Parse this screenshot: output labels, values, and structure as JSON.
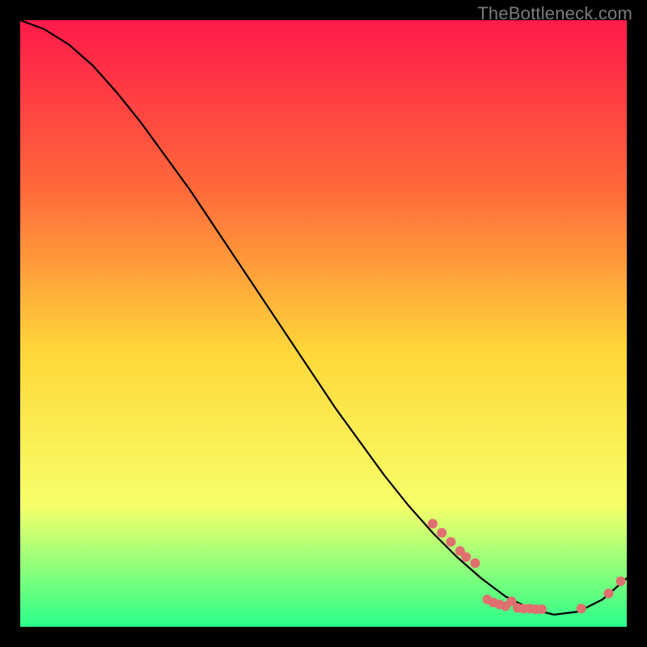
{
  "watermark": "TheBottleneck.com",
  "colors": {
    "background": "#000000",
    "gradient_top": "#ff1a4a",
    "gradient_mid_upper": "#ff6a3a",
    "gradient_mid": "#ffd83a",
    "gradient_lower": "#f7ff6a",
    "gradient_bottom": "#2aff8a",
    "curve": "#000000",
    "marker": "#e07070"
  },
  "chart_data": {
    "type": "line",
    "title": "",
    "xlabel": "",
    "ylabel": "",
    "xlim": [
      0,
      100
    ],
    "ylim": [
      0,
      100
    ],
    "series": [
      {
        "name": "curve",
        "x": [
          0,
          4,
          8,
          12,
          16,
          20,
          24,
          28,
          32,
          36,
          40,
          44,
          48,
          52,
          56,
          60,
          64,
          68,
          72,
          76,
          80,
          84,
          88,
          92,
          96,
          100
        ],
        "y": [
          100,
          98.5,
          96,
          92.5,
          88,
          83,
          77.5,
          72,
          66,
          60,
          54,
          48,
          42,
          36,
          30.5,
          25,
          20,
          15.5,
          11.5,
          8,
          5,
          3,
          2,
          2.5,
          4.5,
          8
        ]
      }
    ],
    "markers": [
      {
        "x": 68,
        "y": 17
      },
      {
        "x": 69.5,
        "y": 15.5
      },
      {
        "x": 71,
        "y": 14
      },
      {
        "x": 72.5,
        "y": 12.5
      },
      {
        "x": 73.5,
        "y": 11.5
      },
      {
        "x": 75,
        "y": 10.5
      },
      {
        "x": 77,
        "y": 4.5
      },
      {
        "x": 78,
        "y": 4
      },
      {
        "x": 79,
        "y": 3.7
      },
      {
        "x": 80,
        "y": 3.4
      },
      {
        "x": 81,
        "y": 4.2
      },
      {
        "x": 82,
        "y": 3.1
      },
      {
        "x": 83,
        "y": 3
      },
      {
        "x": 84,
        "y": 3
      },
      {
        "x": 85,
        "y": 2.9
      },
      {
        "x": 86,
        "y": 2.9
      },
      {
        "x": 92.5,
        "y": 3
      },
      {
        "x": 97,
        "y": 5.5
      },
      {
        "x": 99,
        "y": 7.5
      }
    ]
  }
}
